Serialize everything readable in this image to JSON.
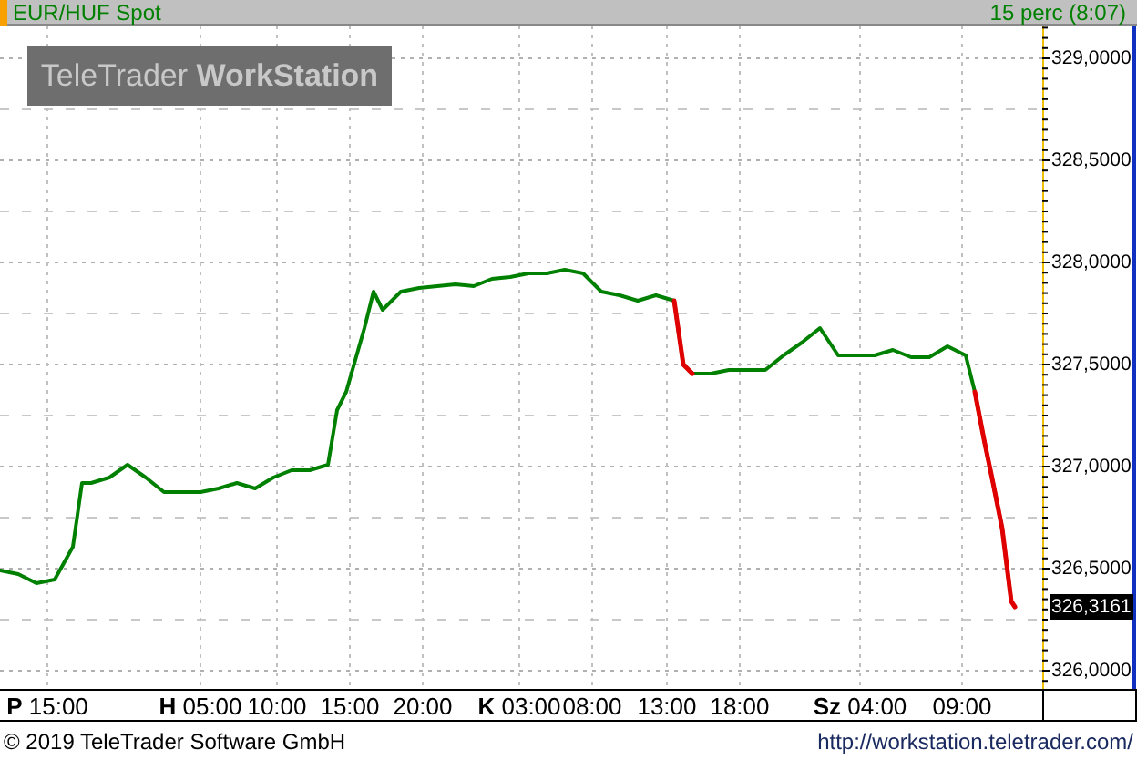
{
  "header": {
    "symbol": "EUR/HUF Spot",
    "delay": "15 perc (8:07)"
  },
  "logo": {
    "text": "TeleTrader **WorkStation**"
  },
  "chart": {
    "price_axis": {
      "labels": [
        "329,0000",
        "328,5000",
        "328,0000",
        "327,5000",
        "327,0000",
        "326,5000",
        "326,0000"
      ],
      "last_price": "326,3161"
    },
    "time_axis": {
      "labels": [
        "**P** 15:00",
        "**H** 05:00",
        "10:00",
        "15:00",
        "20:00",
        "**K** 03:00",
        "08:00",
        "13:00",
        "18:00",
        "**Sz** 04:00",
        "09:00"
      ]
    }
  },
  "footer": {
    "copyright": "© 2019 TeleTrader Software GmbH",
    "link": "http://workstation.teletrader.com/"
  }
}
